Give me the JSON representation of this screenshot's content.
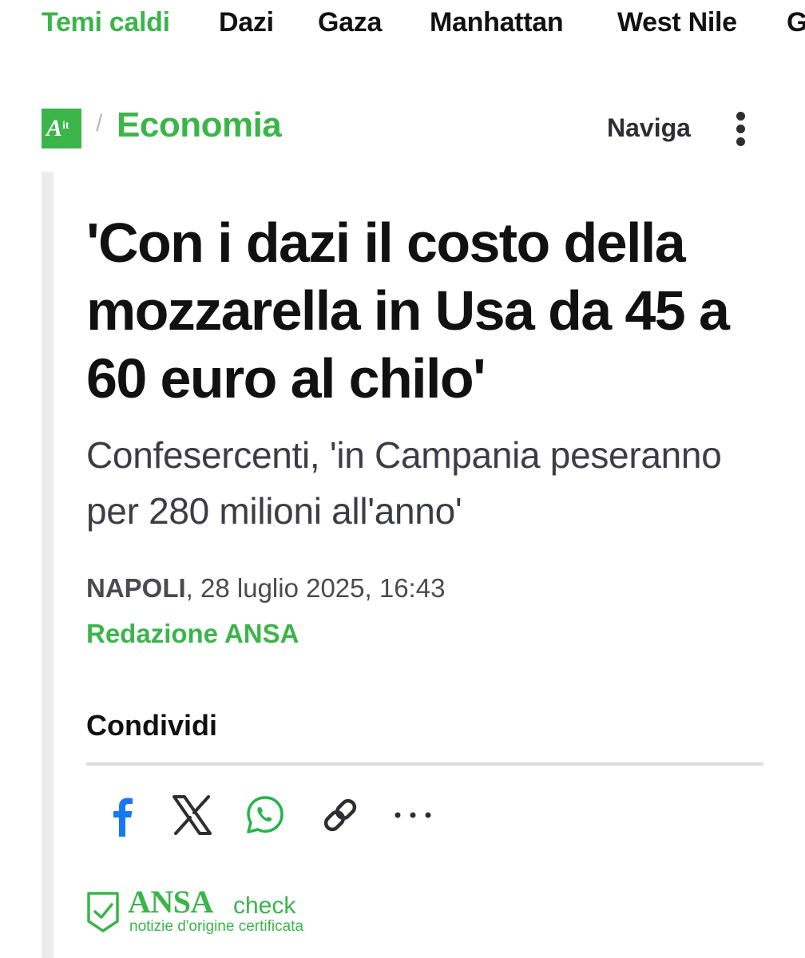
{
  "hot_topics": {
    "label": "Temi caldi",
    "items": [
      "Dazi",
      "Gaza",
      "Manhattan",
      "West Nile",
      "G"
    ]
  },
  "section": {
    "logo_letter": "A",
    "logo_suffix": "it",
    "separator": "/",
    "title": "Economia",
    "nav_label": "Naviga"
  },
  "article": {
    "headline": "'Con i dazi il costo della mozzarella in Usa da 45 a 60 euro al chilo'",
    "subtitle": "Confesercenti, 'in Campania peseranno per 280 milioni all'anno'",
    "city": "NAPOLI",
    "date": ", 28 luglio 2025, 16:43",
    "byline": "Redazione ANSA"
  },
  "share": {
    "label": "Condividi",
    "icons": [
      "facebook-icon",
      "x-icon",
      "whatsapp-icon",
      "link-icon",
      "more-icon"
    ]
  },
  "ansa_check": {
    "brand": "ANSA",
    "check": "check",
    "tagline": "notizie d'origine certificata"
  },
  "colors": {
    "brand_green": "#3bb54a",
    "facebook_blue": "#1877f2",
    "text_dark": "#111111",
    "text_muted": "#3c3c46"
  }
}
